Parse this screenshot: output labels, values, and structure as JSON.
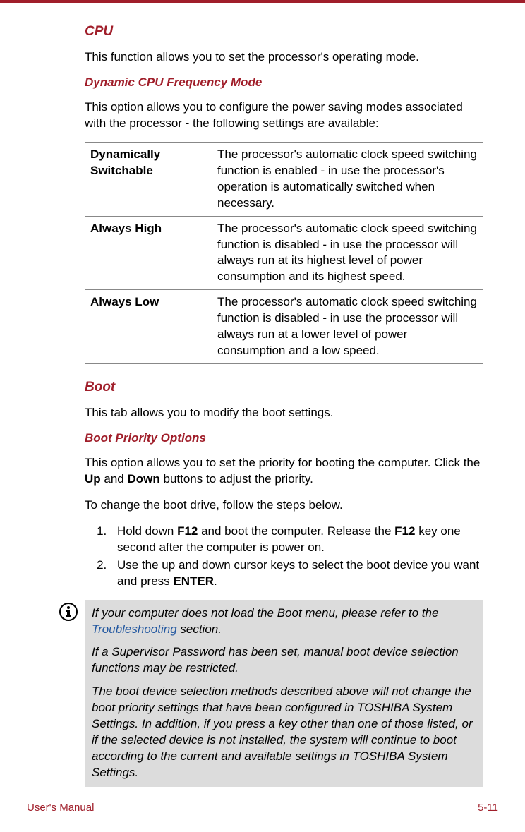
{
  "sections": {
    "cpu": {
      "heading": "CPU",
      "intro": "This function allows you to set the processor's operating mode.",
      "subheading": "Dynamic CPU Frequency Mode",
      "subintro": "This option allows you to configure the power saving modes associated with the processor - the following settings are available:",
      "rows": [
        {
          "label": "Dynamically Switchable",
          "desc": "The processor's automatic clock speed switching function is enabled - in use the processor's operation is automatically switched when necessary."
        },
        {
          "label": "Always High",
          "desc": "The processor's automatic clock speed switching function is disabled - in use the processor will always run at its highest level of power consumption and its highest speed."
        },
        {
          "label": "Always Low",
          "desc": "The processor's automatic clock speed switching function is disabled - in use the processor will always run at a lower level of power consumption and a low speed."
        }
      ]
    },
    "boot": {
      "heading": "Boot",
      "intro": "This tab allows you to modify the boot settings.",
      "subheading": "Boot Priority Options",
      "p1_a": "This option allows you to set the priority for booting the computer. Click the ",
      "p1_b": "Up",
      "p1_c": " and ",
      "p1_d": "Down",
      "p1_e": " buttons to adjust the priority.",
      "p2": "To change the boot drive, follow the steps below.",
      "step1_a": "Hold down ",
      "step1_b": "F12",
      "step1_c": " and boot the computer. Release the ",
      "step1_d": "F12",
      "step1_e": " key one second after the computer is power on.",
      "step2_a": "Use the up and down cursor keys to select the boot device you want and press ",
      "step2_b": "ENTER",
      "step2_c": "."
    },
    "note": {
      "n1_a": "If your computer does not load the Boot menu, please refer to the ",
      "n1_link": "Troubleshooting",
      "n1_b": " section.",
      "n2": "If a Supervisor Password has been set, manual boot device selection functions may be restricted.",
      "n3": "The boot device selection methods described above will not change the boot priority settings that have been configured in TOSHIBA System Settings. In addition, if you press a key other than one of those listed, or if the selected device is not installed, the system will continue to boot according to the current and available settings in TOSHIBA System Settings."
    }
  },
  "footer": {
    "left": "User's Manual",
    "right": "5-11"
  }
}
